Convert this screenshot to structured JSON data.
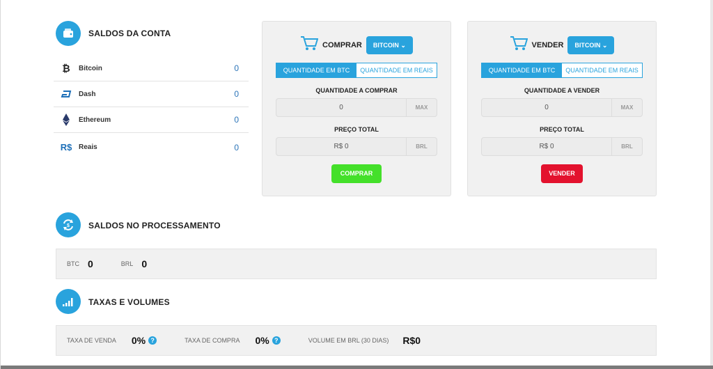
{
  "balances": {
    "title": "SALDOS DA CONTA",
    "items": [
      {
        "name": "Bitcoin",
        "value": "0"
      },
      {
        "name": "Dash",
        "value": "0"
      },
      {
        "name": "Ethereum",
        "value": "0"
      },
      {
        "name": "Reais",
        "value": "0",
        "icon_text": "R$"
      }
    ]
  },
  "buy": {
    "label": "COMPRAR",
    "currency_button": "BITCOIN",
    "tab_btc": "QUANTIDADE EM BTC",
    "tab_reais": "QUANTIDADE EM REAIS",
    "qty_label": "QUANTIDADE A COMPRAR",
    "qty_value": "0",
    "qty_suffix": "MAX",
    "total_label": "PREÇO TOTAL",
    "total_value": "R$ 0",
    "total_suffix": "BRL",
    "action_label": "COMPRAR",
    "action_color": "#44e02a"
  },
  "sell": {
    "label": "VENDER",
    "currency_button": "BITCOIN",
    "tab_btc": "QUANTIDADE EM BTC",
    "tab_reais": "QUANTIDADE EM REAIS",
    "qty_label": "QUANTIDADE A VENDER",
    "qty_value": "0",
    "qty_suffix": "MAX",
    "total_label": "PREÇO TOTAL",
    "total_value": "R$ 0",
    "total_suffix": "BRL",
    "action_label": "VENDER",
    "action_color": "#e3122e"
  },
  "processing": {
    "title": "SALDOS NO PROCESSAMENTO",
    "btc_label": "BTC",
    "btc_value": "0",
    "brl_label": "BRL",
    "brl_value": "0"
  },
  "fees": {
    "title": "TAXAS E VOLUMES",
    "sell_fee_label": "TAXA DE VENDA",
    "sell_fee_value": "0%",
    "buy_fee_label": "TAXA DE COMPRA",
    "buy_fee_value": "0%",
    "volume_label": "VOLUME EM BRL (30 DIAS)",
    "volume_value": "R$0"
  },
  "colors": {
    "accent": "#29a3dd",
    "value_blue": "#2b74b8"
  }
}
